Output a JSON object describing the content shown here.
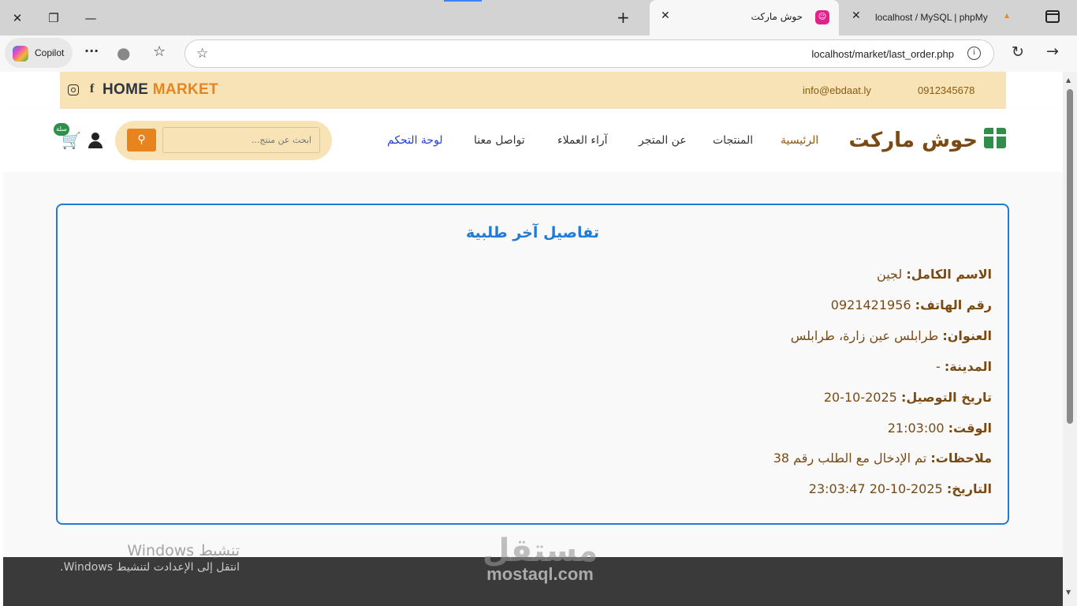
{
  "browser": {
    "tabs": [
      {
        "title": "حوش ماركت",
        "active": true,
        "favicon": "shop-favicon"
      },
      {
        "title": "localhost / MySQL | phpMy",
        "active": false,
        "favicon": "phpmyadmin-favicon"
      }
    ],
    "copilot_label": "Copilot",
    "url": "localhost/market/last_order.php"
  },
  "topstrip": {
    "brand_part1": "HOME",
    "brand_part2": "MARKET",
    "email": "info@ebdaat.ly",
    "phone": "0912345678"
  },
  "navbar": {
    "logo_text": "حوش ماركت",
    "links": [
      "الرئيسية",
      "المنتجات",
      "عن المتجر",
      "آراء العملاء",
      "تواصل معنا",
      "لوحة التحكم"
    ],
    "search_placeholder": "ابحث عن منتج...",
    "cart_badge": "سلة"
  },
  "order": {
    "title": "تفاصيل آخر طلبية",
    "fields": [
      {
        "label": "الاسم الكامل:",
        "value": "لجين"
      },
      {
        "label": "رقم الهاتف:",
        "value": "0921421956"
      },
      {
        "label": "العنوان:",
        "value": "طرابلس عين زارة، طرابلس"
      },
      {
        "label": "المدينة:",
        "value": "-"
      },
      {
        "label": "تاريخ التوصيل:",
        "value": "2025-10-20"
      },
      {
        "label": "الوقت:",
        "value": "21:03:00"
      },
      {
        "label": "ملاحظات:",
        "value": "تم الإدخال مع الطلب رقم 38"
      },
      {
        "label": "التاريخ:",
        "value": "2025-10-20 23:03:47"
      }
    ]
  },
  "watermark": {
    "arabic": "مستقل",
    "latin": "mostaql.com"
  },
  "windows_activation": {
    "title": "تنشيط Windows",
    "subtitle": "انتقل إلى الإعدادت لتنشيط Windows."
  },
  "colors": {
    "brown": "#7a4a12",
    "orange": "#e8841e",
    "blue": "#1e7bd8",
    "cream": "#f7e3b5",
    "green": "#2f8f4a"
  }
}
